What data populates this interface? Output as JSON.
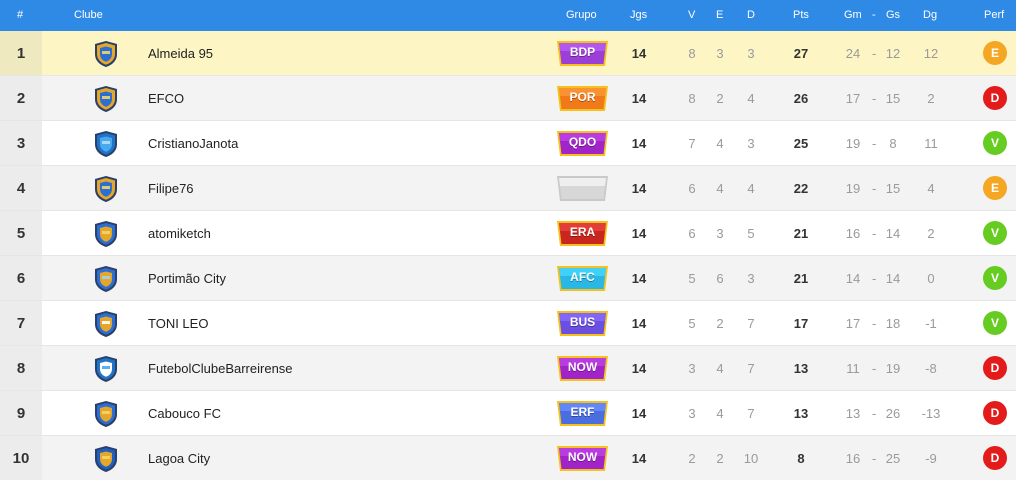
{
  "header": {
    "rank": "#",
    "club": "Clube",
    "group": "Grupo",
    "games": "Jgs",
    "wins": "V",
    "draws": "E",
    "losses": "D",
    "points": "Pts",
    "goals_for": "Gm",
    "goals_against": "Gs",
    "goal_diff": "Dg",
    "form": "Perf"
  },
  "colors": {
    "header_bg": "#2f8ae6",
    "highlight_row": "#fdf6c4",
    "form_E": "#f5a623",
    "form_D": "#e31b1b",
    "form_V": "#66cc22"
  },
  "rows": [
    {
      "rank": "1",
      "club": "Almeida 95",
      "group": "BDP",
      "group_color": "#9b3fd6",
      "games": "14",
      "w": "8",
      "d": "3",
      "l": "3",
      "pts": "27",
      "gf": "24",
      "ga": "12",
      "gd": "12",
      "form": "E",
      "crest_icon": "shield-crest-icon"
    },
    {
      "rank": "2",
      "club": "EFCO",
      "group": "POR",
      "group_color": "#f07a1a",
      "games": "14",
      "w": "8",
      "d": "2",
      "l": "4",
      "pts": "26",
      "gf": "17",
      "ga": "15",
      "gd": "2",
      "form": "D",
      "crest_icon": "shield-crest-icon"
    },
    {
      "rank": "3",
      "club": "CristianoJanota",
      "group": "QDO",
      "group_color": "#a024c8",
      "games": "14",
      "w": "7",
      "d": "4",
      "l": "3",
      "pts": "25",
      "gf": "19",
      "ga": "8",
      "gd": "11",
      "form": "V",
      "crest_icon": "shield-crest-icon"
    },
    {
      "rank": "4",
      "club": "Filipe76",
      "group": "",
      "group_color": "#d7d7d7",
      "games": "14",
      "w": "6",
      "d": "4",
      "l": "4",
      "pts": "22",
      "gf": "19",
      "ga": "15",
      "gd": "4",
      "form": "E",
      "crest_icon": "shield-crest-icon"
    },
    {
      "rank": "5",
      "club": "atomiketch",
      "group": "ERA",
      "group_color": "#c8261e",
      "games": "14",
      "w": "6",
      "d": "3",
      "l": "5",
      "pts": "21",
      "gf": "16",
      "ga": "14",
      "gd": "2",
      "form": "V",
      "crest_icon": "shield-crest-icon"
    },
    {
      "rank": "6",
      "club": "Portimão City",
      "group": "AFC",
      "group_color": "#29b8e6",
      "games": "14",
      "w": "5",
      "d": "6",
      "l": "3",
      "pts": "21",
      "gf": "14",
      "ga": "14",
      "gd": "0",
      "form": "V",
      "crest_icon": "shield-crest-icon"
    },
    {
      "rank": "7",
      "club": "TONI LEO",
      "group": "BUS",
      "group_color": "#6a4fe0",
      "games": "14",
      "w": "5",
      "d": "2",
      "l": "7",
      "pts": "17",
      "gf": "17",
      "ga": "18",
      "gd": "-1",
      "form": "V",
      "crest_icon": "shield-crest-icon"
    },
    {
      "rank": "8",
      "club": "FutebolClubeBarreirense",
      "group": "NOW",
      "group_color": "#a024c8",
      "games": "14",
      "w": "3",
      "d": "4",
      "l": "7",
      "pts": "13",
      "gf": "11",
      "ga": "19",
      "gd": "-8",
      "form": "D",
      "crest_icon": "shield-crest-icon"
    },
    {
      "rank": "9",
      "club": "Cabouco FC",
      "group": "ERF",
      "group_color": "#4a6ee0",
      "games": "14",
      "w": "3",
      "d": "4",
      "l": "7",
      "pts": "13",
      "gf": "13",
      "ga": "26",
      "gd": "-13",
      "form": "D",
      "crest_icon": "shield-crest-icon"
    },
    {
      "rank": "10",
      "club": "Lagoa City",
      "group": "NOW",
      "group_color": "#a024c8",
      "games": "14",
      "w": "2",
      "d": "2",
      "l": "10",
      "pts": "8",
      "gf": "16",
      "ga": "25",
      "gd": "-9",
      "form": "D",
      "crest_icon": "shield-crest-icon"
    }
  ]
}
